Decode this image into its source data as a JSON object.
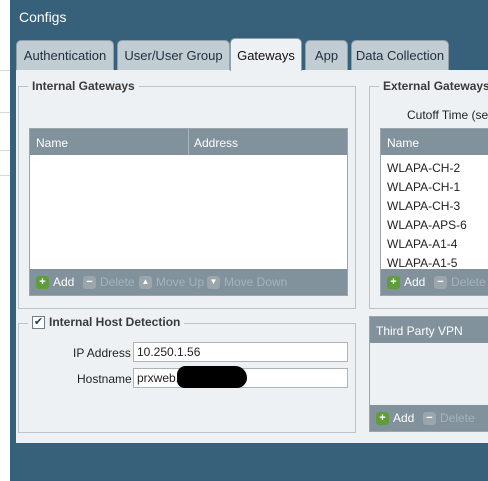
{
  "dialog": {
    "title": "Configs"
  },
  "tabs": [
    {
      "label": "Authentication"
    },
    {
      "label": "User/User Group"
    },
    {
      "label": "Gateways",
      "active": true
    },
    {
      "label": "App"
    },
    {
      "label": "Data Collection"
    }
  ],
  "internal_gateways": {
    "title": "Internal Gateways",
    "columns": [
      "Name",
      "Address"
    ],
    "rows": [],
    "toolbar": {
      "add": "Add",
      "delete": "Delete",
      "move_up": "Move Up",
      "move_down": "Move Down"
    }
  },
  "external_gateways": {
    "title": "External Gateways",
    "cutoff_label": "Cutoff Time (sec)",
    "columns": [
      "Name"
    ],
    "rows": [
      "WLAPA-CH-2",
      "WLAPA-CH-1",
      "WLAPA-CH-3",
      "WLAPA-APS-6",
      "WLAPA-A1-4",
      "WLAPA-A1-5"
    ],
    "toolbar": {
      "add": "Add",
      "delete": "Delete"
    }
  },
  "internal_host_detection": {
    "title": "Internal Host Detection",
    "checked": true,
    "ip_address_label": "IP Address",
    "ip_address_value": "10.250.1.56",
    "hostname_label": "Hostname",
    "hostname_value": "prxweb.l"
  },
  "third_party_vpn": {
    "title": "Third Party VPN",
    "toolbar": {
      "add": "Add",
      "delete": "Delete"
    }
  },
  "colors": {
    "dialog_bg": "#37607a",
    "panel_bg": "#eef1f4",
    "grid_header": "#82929d",
    "add_icon": "#5f9d3a"
  }
}
